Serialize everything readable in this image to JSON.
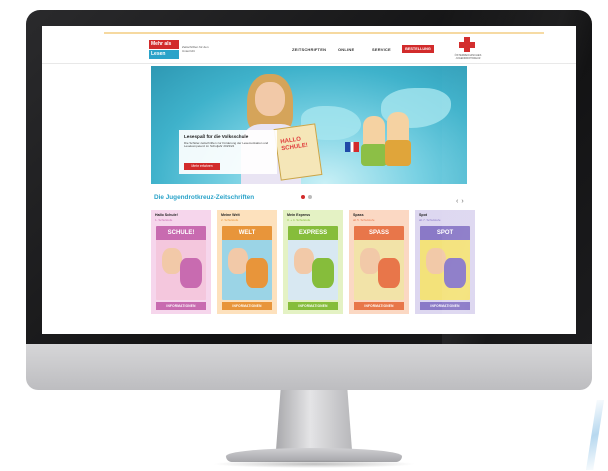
{
  "logo": {
    "line1": "Mehr als",
    "line2": "Lesen",
    "subtitle": "Zeitschriften für den Unterricht"
  },
  "nav": {
    "items": [
      "ZEITSCHRIFTEN",
      "ONLINE",
      "SERVICE"
    ],
    "order_label": "BESTELLUNG"
  },
  "partner": {
    "text": "ÖSTERREICHISCHES JUGENDROTKREUZ"
  },
  "hero": {
    "book_text": "HALLO SCHULE!",
    "promo_title": "Lesespaß für die Volksschule",
    "promo_text": "Die Schüler-zeitschriften zur Förderung der Lesemotivation und Lesekompetenz im Schuljahr 2023/24",
    "promo_button": "Mehr erfahren"
  },
  "section": {
    "title": "Die Jugendrotkreuz-Zeitschriften",
    "prev": "‹",
    "next": "›"
  },
  "cards": [
    {
      "name": "Hallo Schule!",
      "grade": "1. Schulstufe",
      "mast": "SCHULE!",
      "button": "INFORMATIONEN",
      "bg": "#f6d6ec",
      "accent": "#c86bb0",
      "cover": "#f4c7dd"
    },
    {
      "name": "Meine Welt",
      "grade": "2. Schulstufe",
      "mast": "WELT",
      "button": "INFORMATIONEN",
      "bg": "#fde1bd",
      "accent": "#e8953a",
      "cover": "#9bd4e6"
    },
    {
      "name": "Mein Express",
      "grade": "3. + 4. Schulstufe",
      "mast": "EXPRESS",
      "button": "INFORMATIONEN",
      "bg": "#e4f2c4",
      "accent": "#86bd3b",
      "cover": "#d8e8f2"
    },
    {
      "name": "Spass",
      "grade": "ab 5. Schulstufe",
      "mast": "SPASS",
      "button": "INFORMATIONEN",
      "bg": "#fbd8c3",
      "accent": "#e8764a",
      "cover": "#f2e3a8"
    },
    {
      "name": "Spot",
      "grade": "ab 7. Schulstufe",
      "mast": "SPOT",
      "button": "INFORMATIONEN",
      "bg": "#ddd7f0",
      "accent": "#8a79c7",
      "cover": "#f3e27a"
    }
  ],
  "colors": {
    "red": "#d22b2b",
    "teal": "#2aa3c9"
  }
}
